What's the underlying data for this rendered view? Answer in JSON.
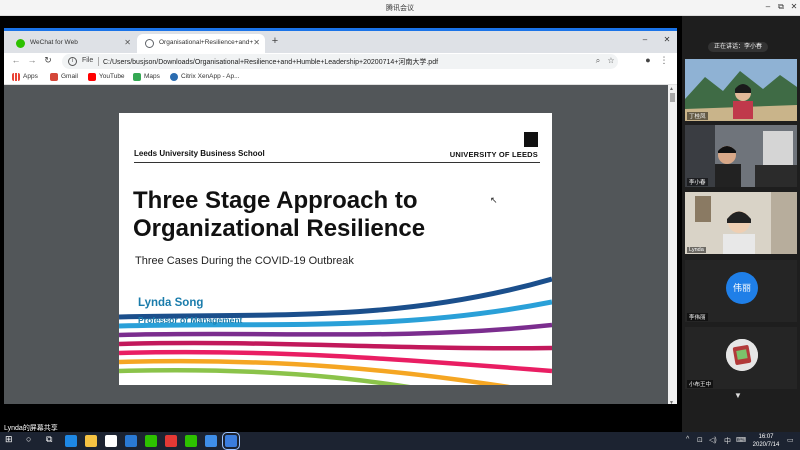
{
  "meeting": {
    "title": "腾讯会议",
    "minimize": "–",
    "restore": "⧉",
    "close": "✕",
    "share_status": "Lynda的屏幕共享",
    "speaking_label": "正在讲话：李小春"
  },
  "browser": {
    "tabs": [
      {
        "label": "WeChat for Web",
        "close": "✕",
        "icon_color": "#2dc100"
      },
      {
        "label": "Organisational+Resilience+and+",
        "close": "✕",
        "icon_color": "#5f6368"
      }
    ],
    "newtab": "+",
    "win_minimize": "–",
    "win_restore": "⧉",
    "win_close": "✕",
    "nav_back": "←",
    "nav_forward": "→",
    "nav_reload": "↻",
    "info": "i",
    "file_label": "File",
    "url": "C:/Users/busjson/Downloads/Organisational+Resilience+and+Humble+Leadership+20200714+河南大学.pdf",
    "zoom_icon": "⌕",
    "star_icon": "☆",
    "account_icon": "●",
    "menu_icon": "⋮",
    "bookmarks": [
      {
        "label": "Apps",
        "color": "#ea4335"
      },
      {
        "label": "Gmail",
        "color": "#d44638"
      },
      {
        "label": "YouTube",
        "color": "#ff0000"
      },
      {
        "label": "Maps",
        "color": "#34a853"
      },
      {
        "label": "Citrix XenApp - Ap...",
        "color": "#2b6cb0"
      }
    ]
  },
  "slide": {
    "school": "Leeds University Business School",
    "university": "UNIVERSITY OF LEEDS",
    "title_line1": "Three Stage Approach to",
    "title_line2": "Organizational Resilience",
    "subtitle": "Three Cases During the COVID-19 Outbreak",
    "author": "Lynda Song",
    "author_role": "Professor of Management",
    "wave_colors": [
      "#1b4f8c",
      "#2aa0d8",
      "#7b2d8e",
      "#c2185b",
      "#e91e63",
      "#f5a623",
      "#8bc34a"
    ]
  },
  "participants": [
    {
      "name": "丁桂凤",
      "kind": "video",
      "bg": "#6a8fb3"
    },
    {
      "name": "李小春",
      "kind": "video",
      "bg": "#7a7f86"
    },
    {
      "name": "Lynda",
      "kind": "video",
      "bg": "#c9c3b8"
    },
    {
      "name": "李伟丽",
      "kind": "avatar",
      "avatar_text": "伟丽"
    },
    {
      "name": "小布王中",
      "kind": "image"
    }
  ],
  "panel_more": "▼",
  "taskbar": {
    "start": "⊞",
    "search": "○",
    "taskview": "⧉",
    "apps": [
      {
        "name": "edge",
        "color": "#1e88e5"
      },
      {
        "name": "explorer",
        "color": "#f6c343"
      },
      {
        "name": "store",
        "color": "#ffffff"
      },
      {
        "name": "mail",
        "color": "#2a7ad5"
      },
      {
        "name": "wechat-pc",
        "color": "#2dc100"
      },
      {
        "name": "foxit",
        "color": "#e53935"
      },
      {
        "name": "wechat",
        "color": "#2dc100"
      },
      {
        "name": "dictionary",
        "color": "#3f8ee8"
      },
      {
        "name": "tencent-meeting",
        "color": "#3b7ddd"
      }
    ],
    "tray_up": "^",
    "tray_net": "⊡",
    "tray_vol": "◁)",
    "tray_lang": "中",
    "tray_ime": "⌨",
    "time": "16:07",
    "date": "2020/7/14",
    "notif": "▭"
  }
}
